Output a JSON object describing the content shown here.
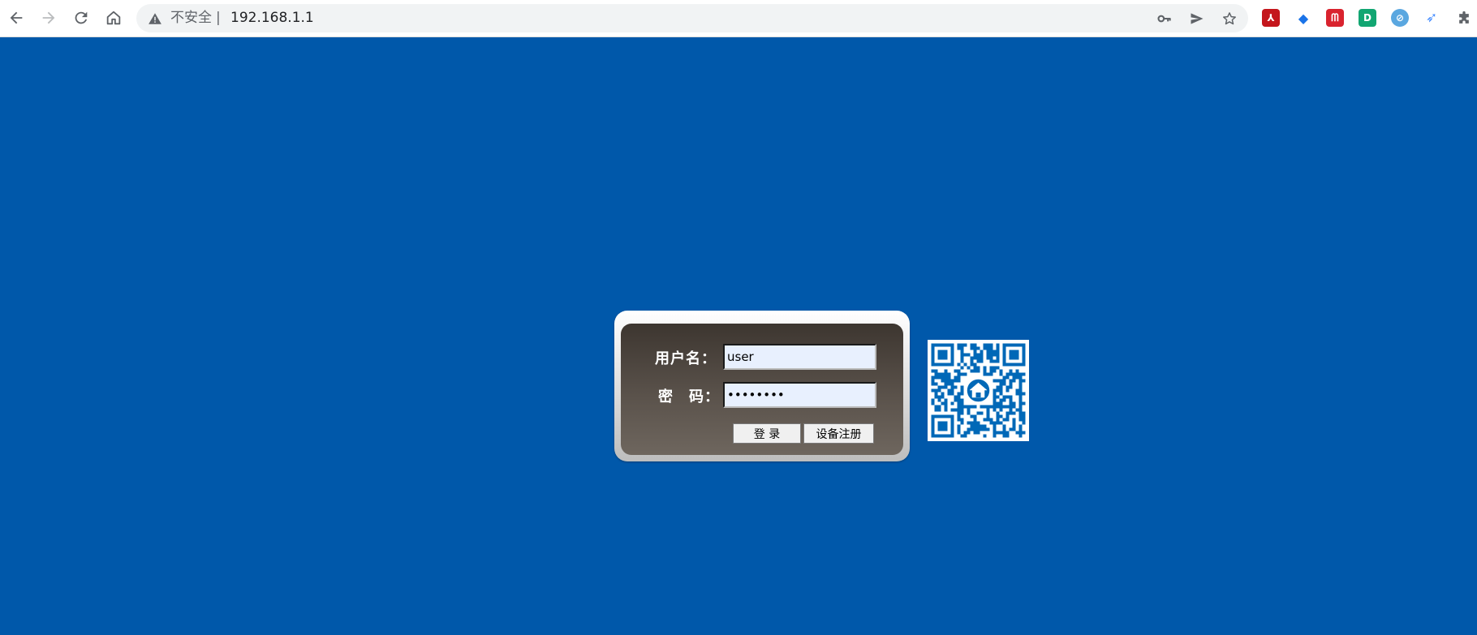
{
  "browser": {
    "security_label": "不安全",
    "separator": "|",
    "url": "192.168.1.1",
    "nav_icons": [
      "back-icon",
      "forward-icon",
      "reload-icon",
      "home-icon"
    ],
    "omnibox_icons": [
      "key-icon",
      "send-icon",
      "star-icon"
    ],
    "extensions": [
      {
        "name": "pdf-extension-icon",
        "color": "#c4161c",
        "glyph": "⅄"
      },
      {
        "name": "edu-extension-icon",
        "color": "#1a73e8",
        "glyph": "◆"
      },
      {
        "name": "mendeley-extension-icon",
        "color": "#d9232e",
        "glyph": "ᗰ"
      },
      {
        "name": "d-extension-icon",
        "color": "#12a672",
        "glyph": "D"
      },
      {
        "name": "compass-extension-icon",
        "color": "#5aa7e0",
        "glyph": "⊘"
      },
      {
        "name": "bird-extension-icon",
        "color": "#4a90ff",
        "glyph": "➶"
      }
    ]
  },
  "colors": {
    "page_background": "#0058aa",
    "qr_blue": "#0068b7"
  },
  "login": {
    "username_label": "用户名：",
    "username_value": "user",
    "password_label": "密　码：",
    "password_value": "password",
    "login_button": "登 录",
    "register_button": "设备注册"
  },
  "qr_code": {
    "center_icon": "home-icon"
  }
}
